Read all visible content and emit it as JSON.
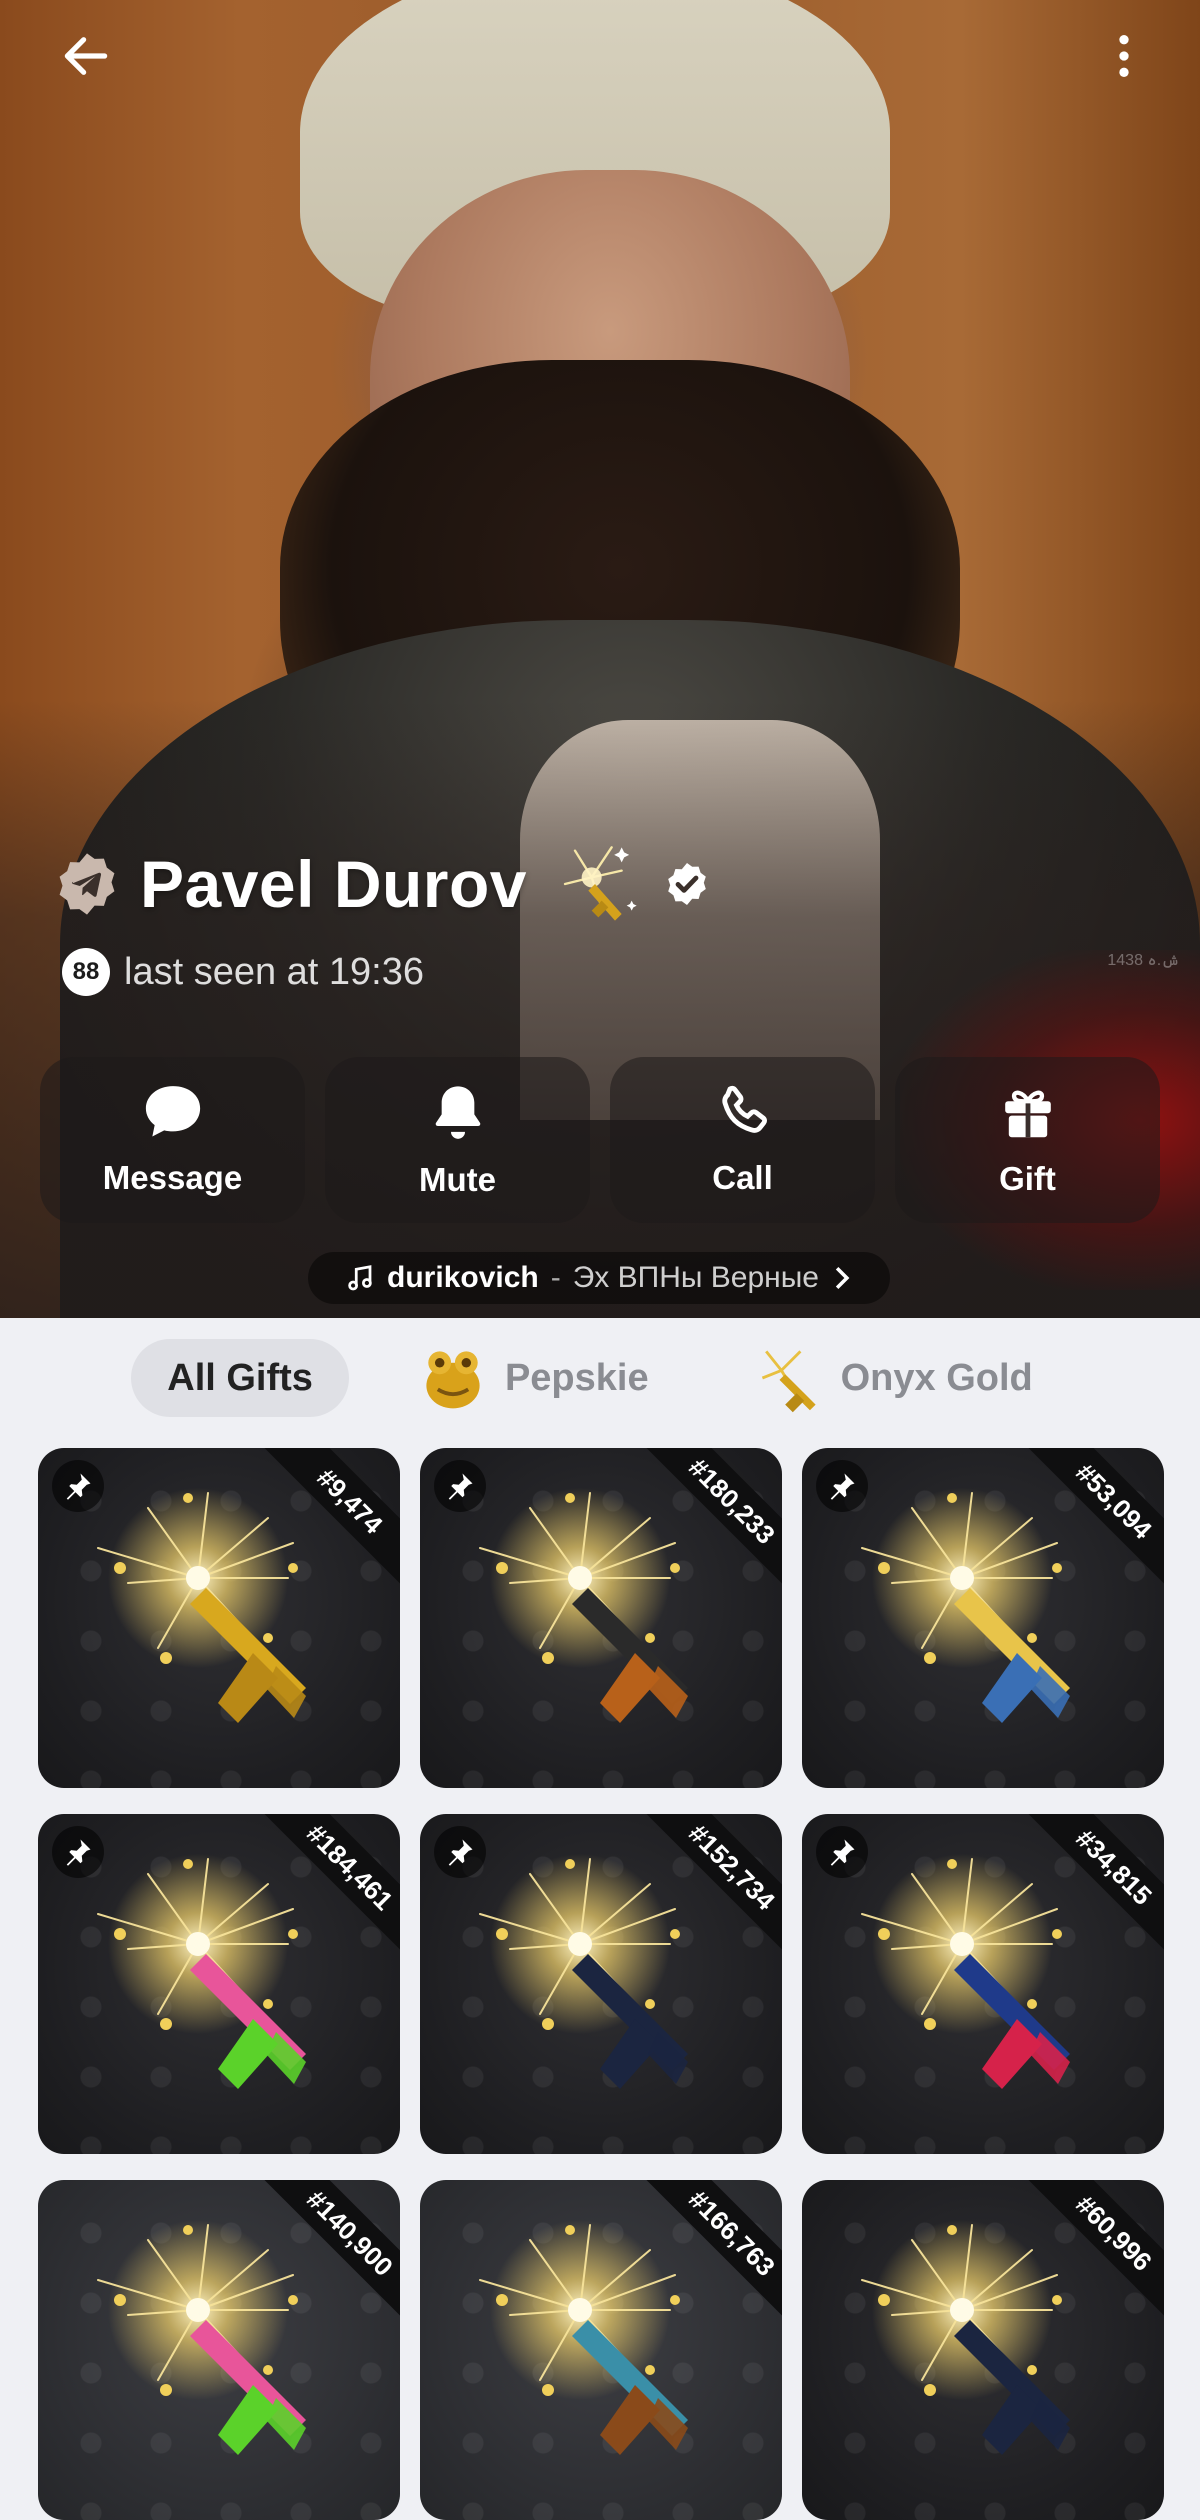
{
  "profile": {
    "name": "Pavel Durov",
    "status": "last seen at 19:36",
    "level": "88",
    "photo_caption": "1438 ش.ہ"
  },
  "actions": [
    {
      "label": "Message",
      "icon": "chat-bubble-icon"
    },
    {
      "label": "Mute",
      "icon": "bell-icon"
    },
    {
      "label": "Call",
      "icon": "phone-icon"
    },
    {
      "label": "Gift",
      "icon": "gift-icon"
    }
  ],
  "music": {
    "artist": "durikovich",
    "separator": "-",
    "track": "Эх ВПНы Верные"
  },
  "tabs": [
    {
      "label": "All Gifts",
      "active": true
    },
    {
      "label": "Pepskie",
      "active": false
    },
    {
      "label": "Onyx Gold",
      "active": false
    }
  ],
  "gifts": [
    {
      "number": "#9,474",
      "pinned": true,
      "body": "#d8a81e",
      "stock": "#b98916"
    },
    {
      "number": "#180,233",
      "pinned": true,
      "body": "#2a2a2a",
      "stock": "#b8611a"
    },
    {
      "number": "#53,094",
      "pinned": true,
      "body": "#e8c44a",
      "stock": "#3a6fb5"
    },
    {
      "number": "#184,461",
      "pinned": true,
      "body": "#e8559a",
      "stock": "#5bd22a"
    },
    {
      "number": "#152,734",
      "pinned": true,
      "body": "#1b2540",
      "stock": "#1b2540"
    },
    {
      "number": "#34,815",
      "pinned": true,
      "body": "#1f3a8a",
      "stock": "#d6224a"
    },
    {
      "number": "#140,900",
      "pinned": false,
      "body": "#e8559a",
      "stock": "#5bd22a"
    },
    {
      "number": "#166,763",
      "pinned": false,
      "body": "#3a8fa8",
      "stock": "#8a4a1a"
    },
    {
      "number": "#60,996",
      "pinned": false,
      "body": "#1b2540",
      "stock": "#1b2540"
    }
  ],
  "colors": {
    "accent_white": "#ffffff",
    "tab_active_bg": "#dfe0e5",
    "card_bg": "#1e1e21"
  }
}
